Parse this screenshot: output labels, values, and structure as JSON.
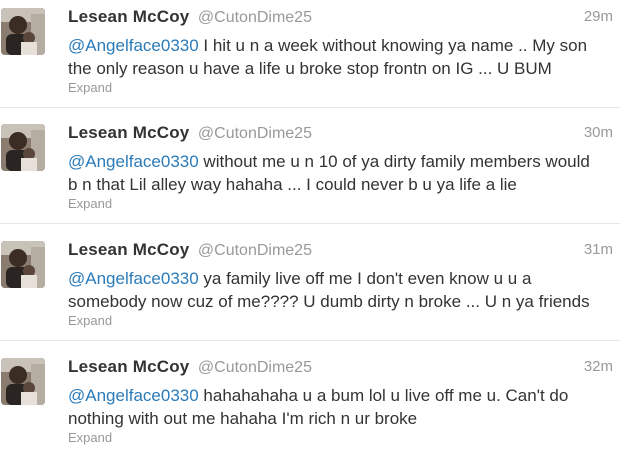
{
  "tweets": [
    {
      "name": "Lesean McCoy",
      "handle": "@CutonDime25",
      "time": "29m",
      "mention": "@Angelface0330",
      "line1": " I hit u n a week without knowing ya name .. My son",
      "line2": "the only reason u have a life u broke stop frontn on IG ... U BUM",
      "expand": "Expand"
    },
    {
      "name": "Lesean McCoy",
      "handle": "@CutonDime25",
      "time": "30m",
      "mention": "@Angelface0330",
      "line1": " without me u n 10 of ya dirty family members would",
      "line2": "b n that Lil alley way hahaha ... I could never b u ya life a lie",
      "expand": "Expand"
    },
    {
      "name": "Lesean McCoy",
      "handle": "@CutonDime25",
      "time": "31m",
      "mention": "@Angelface0330",
      "line1": " ya family live off me I don't even know u u a",
      "line2": "somebody now cuz of me???? U dumb dirty n broke ... U n ya friends",
      "expand": "Expand"
    },
    {
      "name": "Lesean McCoy",
      "handle": "@CutonDime25",
      "time": "32m",
      "mention": "@Angelface0330",
      "line1": " hahahahaha u a bum lol u live off me u. Can't do",
      "line2": "nothing with out me hahaha I'm rich n ur broke",
      "expand": "Expand"
    }
  ]
}
